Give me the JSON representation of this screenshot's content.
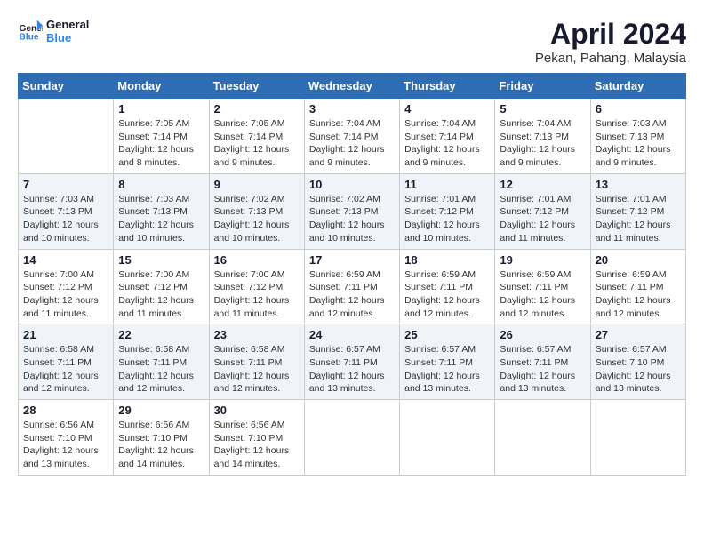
{
  "header": {
    "logo_line1": "General",
    "logo_line2": "Blue",
    "month": "April 2024",
    "location": "Pekan, Pahang, Malaysia"
  },
  "weekdays": [
    "Sunday",
    "Monday",
    "Tuesday",
    "Wednesday",
    "Thursday",
    "Friday",
    "Saturday"
  ],
  "weeks": [
    [
      {
        "day": "",
        "sunrise": "",
        "sunset": "",
        "daylight": ""
      },
      {
        "day": "1",
        "sunrise": "Sunrise: 7:05 AM",
        "sunset": "Sunset: 7:14 PM",
        "daylight": "Daylight: 12 hours and 8 minutes."
      },
      {
        "day": "2",
        "sunrise": "Sunrise: 7:05 AM",
        "sunset": "Sunset: 7:14 PM",
        "daylight": "Daylight: 12 hours and 9 minutes."
      },
      {
        "day": "3",
        "sunrise": "Sunrise: 7:04 AM",
        "sunset": "Sunset: 7:14 PM",
        "daylight": "Daylight: 12 hours and 9 minutes."
      },
      {
        "day": "4",
        "sunrise": "Sunrise: 7:04 AM",
        "sunset": "Sunset: 7:14 PM",
        "daylight": "Daylight: 12 hours and 9 minutes."
      },
      {
        "day": "5",
        "sunrise": "Sunrise: 7:04 AM",
        "sunset": "Sunset: 7:13 PM",
        "daylight": "Daylight: 12 hours and 9 minutes."
      },
      {
        "day": "6",
        "sunrise": "Sunrise: 7:03 AM",
        "sunset": "Sunset: 7:13 PM",
        "daylight": "Daylight: 12 hours and 9 minutes."
      }
    ],
    [
      {
        "day": "7",
        "sunrise": "Sunrise: 7:03 AM",
        "sunset": "Sunset: 7:13 PM",
        "daylight": "Daylight: 12 hours and 10 minutes."
      },
      {
        "day": "8",
        "sunrise": "Sunrise: 7:03 AM",
        "sunset": "Sunset: 7:13 PM",
        "daylight": "Daylight: 12 hours and 10 minutes."
      },
      {
        "day": "9",
        "sunrise": "Sunrise: 7:02 AM",
        "sunset": "Sunset: 7:13 PM",
        "daylight": "Daylight: 12 hours and 10 minutes."
      },
      {
        "day": "10",
        "sunrise": "Sunrise: 7:02 AM",
        "sunset": "Sunset: 7:13 PM",
        "daylight": "Daylight: 12 hours and 10 minutes."
      },
      {
        "day": "11",
        "sunrise": "Sunrise: 7:01 AM",
        "sunset": "Sunset: 7:12 PM",
        "daylight": "Daylight: 12 hours and 10 minutes."
      },
      {
        "day": "12",
        "sunrise": "Sunrise: 7:01 AM",
        "sunset": "Sunset: 7:12 PM",
        "daylight": "Daylight: 12 hours and 11 minutes."
      },
      {
        "day": "13",
        "sunrise": "Sunrise: 7:01 AM",
        "sunset": "Sunset: 7:12 PM",
        "daylight": "Daylight: 12 hours and 11 minutes."
      }
    ],
    [
      {
        "day": "14",
        "sunrise": "Sunrise: 7:00 AM",
        "sunset": "Sunset: 7:12 PM",
        "daylight": "Daylight: 12 hours and 11 minutes."
      },
      {
        "day": "15",
        "sunrise": "Sunrise: 7:00 AM",
        "sunset": "Sunset: 7:12 PM",
        "daylight": "Daylight: 12 hours and 11 minutes."
      },
      {
        "day": "16",
        "sunrise": "Sunrise: 7:00 AM",
        "sunset": "Sunset: 7:12 PM",
        "daylight": "Daylight: 12 hours and 11 minutes."
      },
      {
        "day": "17",
        "sunrise": "Sunrise: 6:59 AM",
        "sunset": "Sunset: 7:11 PM",
        "daylight": "Daylight: 12 hours and 12 minutes."
      },
      {
        "day": "18",
        "sunrise": "Sunrise: 6:59 AM",
        "sunset": "Sunset: 7:11 PM",
        "daylight": "Daylight: 12 hours and 12 minutes."
      },
      {
        "day": "19",
        "sunrise": "Sunrise: 6:59 AM",
        "sunset": "Sunset: 7:11 PM",
        "daylight": "Daylight: 12 hours and 12 minutes."
      },
      {
        "day": "20",
        "sunrise": "Sunrise: 6:59 AM",
        "sunset": "Sunset: 7:11 PM",
        "daylight": "Daylight: 12 hours and 12 minutes."
      }
    ],
    [
      {
        "day": "21",
        "sunrise": "Sunrise: 6:58 AM",
        "sunset": "Sunset: 7:11 PM",
        "daylight": "Daylight: 12 hours and 12 minutes."
      },
      {
        "day": "22",
        "sunrise": "Sunrise: 6:58 AM",
        "sunset": "Sunset: 7:11 PM",
        "daylight": "Daylight: 12 hours and 12 minutes."
      },
      {
        "day": "23",
        "sunrise": "Sunrise: 6:58 AM",
        "sunset": "Sunset: 7:11 PM",
        "daylight": "Daylight: 12 hours and 12 minutes."
      },
      {
        "day": "24",
        "sunrise": "Sunrise: 6:57 AM",
        "sunset": "Sunset: 7:11 PM",
        "daylight": "Daylight: 12 hours and 13 minutes."
      },
      {
        "day": "25",
        "sunrise": "Sunrise: 6:57 AM",
        "sunset": "Sunset: 7:11 PM",
        "daylight": "Daylight: 12 hours and 13 minutes."
      },
      {
        "day": "26",
        "sunrise": "Sunrise: 6:57 AM",
        "sunset": "Sunset: 7:11 PM",
        "daylight": "Daylight: 12 hours and 13 minutes."
      },
      {
        "day": "27",
        "sunrise": "Sunrise: 6:57 AM",
        "sunset": "Sunset: 7:10 PM",
        "daylight": "Daylight: 12 hours and 13 minutes."
      }
    ],
    [
      {
        "day": "28",
        "sunrise": "Sunrise: 6:56 AM",
        "sunset": "Sunset: 7:10 PM",
        "daylight": "Daylight: 12 hours and 13 minutes."
      },
      {
        "day": "29",
        "sunrise": "Sunrise: 6:56 AM",
        "sunset": "Sunset: 7:10 PM",
        "daylight": "Daylight: 12 hours and 14 minutes."
      },
      {
        "day": "30",
        "sunrise": "Sunrise: 6:56 AM",
        "sunset": "Sunset: 7:10 PM",
        "daylight": "Daylight: 12 hours and 14 minutes."
      },
      {
        "day": "",
        "sunrise": "",
        "sunset": "",
        "daylight": ""
      },
      {
        "day": "",
        "sunrise": "",
        "sunset": "",
        "daylight": ""
      },
      {
        "day": "",
        "sunrise": "",
        "sunset": "",
        "daylight": ""
      },
      {
        "day": "",
        "sunrise": "",
        "sunset": "",
        "daylight": ""
      }
    ]
  ]
}
